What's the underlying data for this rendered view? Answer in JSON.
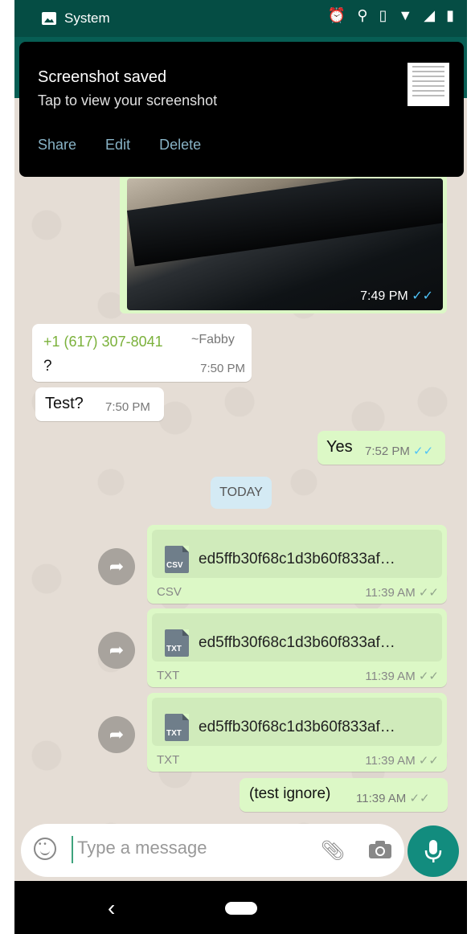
{
  "status_bar": {
    "app_label": "System"
  },
  "notification": {
    "title": "Screenshot saved",
    "subtitle": "Tap to view your screenshot",
    "actions": [
      "Share",
      "Edit",
      "Delete"
    ]
  },
  "messages": {
    "image_msg": {
      "time": "7:49 PM"
    },
    "incoming_1": {
      "phone": "+1 (617) 307-8041",
      "name": "~Fabby",
      "text": "?",
      "time": "7:50 PM"
    },
    "incoming_2": {
      "text": "Test?",
      "time": "7:50 PM"
    },
    "outgoing_1": {
      "text": "Yes",
      "time": "7:52 PM"
    },
    "date_chip": "TODAY",
    "files": [
      {
        "ext": "CSV",
        "name": "ed5ffb30f68c1d3b60f833af…",
        "type": "CSV",
        "time": "11:39 AM"
      },
      {
        "ext": "TXT",
        "name": "ed5ffb30f68c1d3b60f833af…",
        "type": "TXT",
        "time": "11:39 AM"
      },
      {
        "ext": "TXT",
        "name": "ed5ffb30f68c1d3b60f833af…",
        "type": "TXT",
        "time": "11:39 AM"
      }
    ],
    "outgoing_last": {
      "text": "(test ignore)",
      "time": "11:39 AM"
    }
  },
  "composer": {
    "placeholder": "Type a message"
  },
  "colors": {
    "accent": "#128c7e",
    "bubble_out": "#dcf8c6",
    "bg": "#e5ddd5",
    "header": "#075e54"
  }
}
